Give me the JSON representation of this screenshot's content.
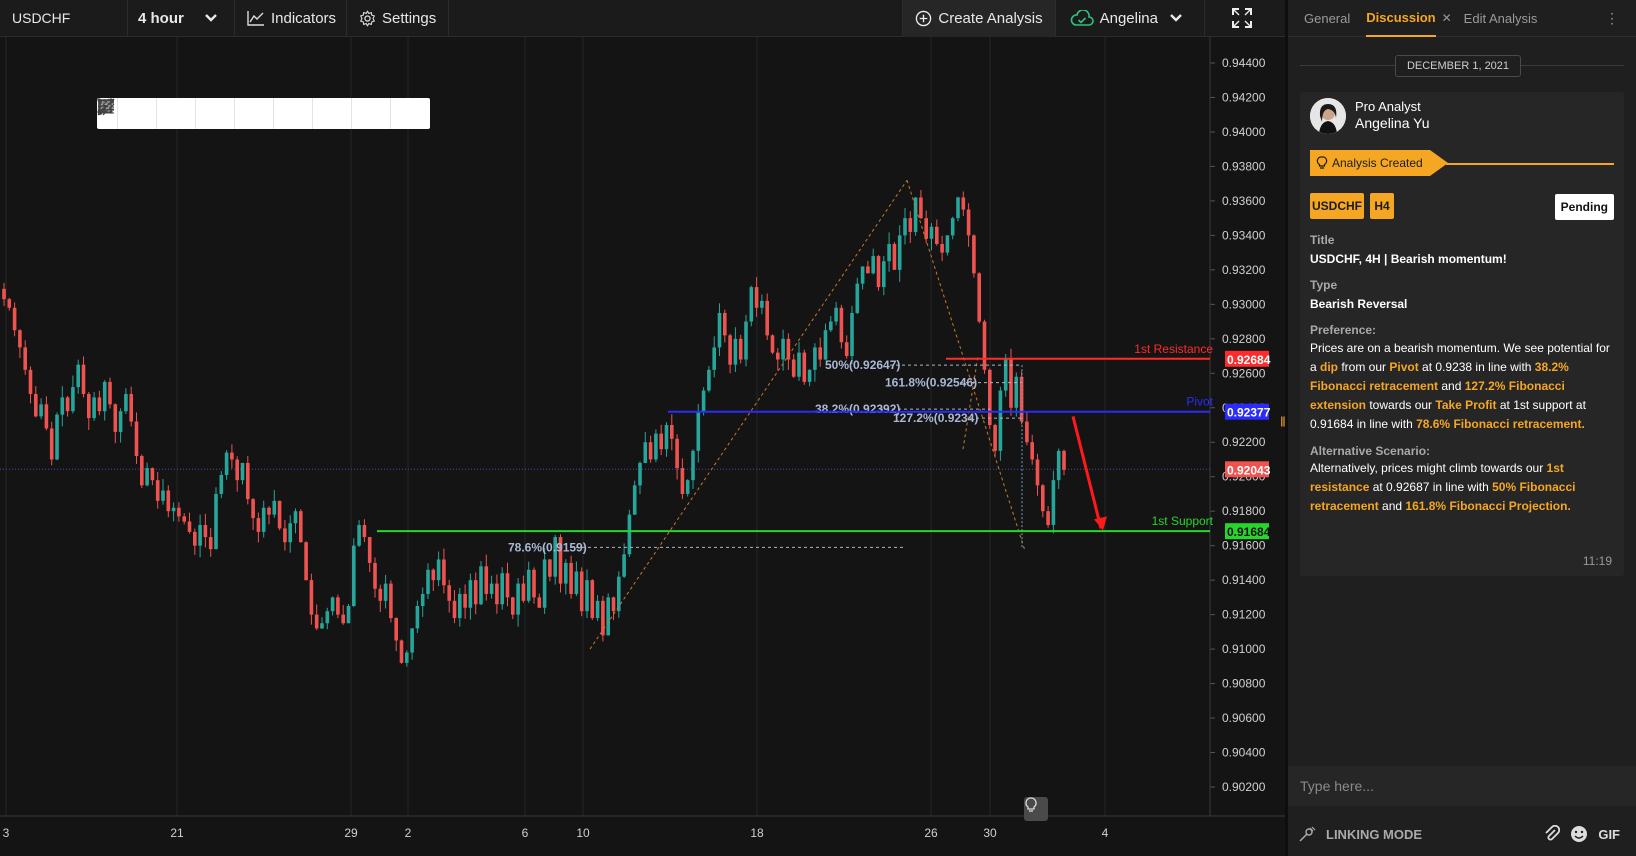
{
  "topbar": {
    "symbol": "USDCHF",
    "interval": "4 hour",
    "indicators": "Indicators",
    "settings": "Settings",
    "create_analysis": "Create Analysis",
    "user": "Angelina"
  },
  "chart_data": {
    "type": "candlestick",
    "symbol": "USDCHF",
    "timeframe": "4 hour",
    "ylim": [
      0.902,
      0.945
    ],
    "y_ticks": [
      "0.94400",
      "0.94200",
      "0.94000",
      "0.93800",
      "0.93600",
      "0.93400",
      "0.93200",
      "0.93000",
      "0.92800",
      "0.92600",
      "0.92400",
      "0.92200",
      "0.92000",
      "0.91800",
      "0.91600",
      "0.91400",
      "0.91200",
      "0.91000",
      "0.90800",
      "0.90600",
      "0.90400",
      "0.90200"
    ],
    "x_ticks": [
      "3",
      "21",
      "29",
      "2",
      "6",
      "10",
      "18",
      "26",
      "30",
      "4"
    ],
    "price_lines": [
      {
        "name": "1st Resistance",
        "value": "0.92684",
        "color": "#ff2b2b"
      },
      {
        "name": "Pivot",
        "value": "0.92377",
        "color": "#2b2bff"
      },
      {
        "name": "1st Support",
        "value": "0.91684",
        "color": "#27d62b"
      }
    ],
    "current_price": "0.92043",
    "fibonacci_labels": [
      {
        "text": "50%(0.92647)",
        "value": 0.92647
      },
      {
        "text": "161.8%(0.92546)",
        "value": 0.92546
      },
      {
        "text": "38.2%(0.92392)",
        "value": 0.92392
      },
      {
        "text": "127.2%(0.9234)",
        "value": 0.9234
      },
      {
        "text": "78.6%(0.9159)",
        "value": 0.9159
      }
    ],
    "path_close": [
      0.9303,
      0.9298,
      0.9285,
      0.9275,
      0.9262,
      0.9248,
      0.9235,
      0.9242,
      0.9228,
      0.921,
      0.9236,
      0.9246,
      0.9238,
      0.9252,
      0.9265,
      0.9248,
      0.9234,
      0.9246,
      0.9238,
      0.9255,
      0.9242,
      0.9226,
      0.9238,
      0.9248,
      0.9232,
      0.9212,
      0.9195,
      0.9205,
      0.9198,
      0.9186,
      0.9192,
      0.918,
      0.9182,
      0.9177,
      0.9174,
      0.9168,
      0.916,
      0.9172,
      0.9165,
      0.9158,
      0.919,
      0.9201,
      0.9214,
      0.921,
      0.9198,
      0.9208,
      0.9187,
      0.9176,
      0.9168,
      0.9182,
      0.9178,
      0.9186,
      0.917,
      0.9162,
      0.9173,
      0.918,
      0.9162,
      0.914,
      0.912,
      0.9112,
      0.9115,
      0.9122,
      0.913,
      0.912,
      0.9115,
      0.9125,
      0.916,
      0.9172,
      0.9165,
      0.915,
      0.9135,
      0.9128,
      0.9138,
      0.9118,
      0.9105,
      0.9092,
      0.9098,
      0.9112,
      0.9125,
      0.9132,
      0.9146,
      0.914,
      0.9152,
      0.9137,
      0.9128,
      0.9118,
      0.9132,
      0.9124,
      0.914,
      0.9126,
      0.9148,
      0.9132,
      0.9138,
      0.9126,
      0.9144,
      0.913,
      0.912,
      0.9138,
      0.9128,
      0.9146,
      0.913,
      0.9124,
      0.9152,
      0.9142,
      0.9165,
      0.9138,
      0.915,
      0.9132,
      0.9145,
      0.9122,
      0.914,
      0.9118,
      0.9128,
      0.9108,
      0.913,
      0.9122,
      0.9142,
      0.9155,
      0.9178,
      0.9195,
      0.9208,
      0.922,
      0.921,
      0.9225,
      0.9216,
      0.923,
      0.9222,
      0.9205,
      0.919,
      0.9198,
      0.9215,
      0.9238,
      0.925,
      0.9262,
      0.9275,
      0.9295,
      0.9282,
      0.9265,
      0.928,
      0.9268,
      0.929,
      0.931,
      0.9298,
      0.9302,
      0.9282,
      0.9272,
      0.9268,
      0.928,
      0.9268,
      0.9258,
      0.9272,
      0.9255,
      0.9262,
      0.9275,
      0.9268,
      0.9285,
      0.929,
      0.9298,
      0.9278,
      0.927,
      0.9295,
      0.9312,
      0.9322,
      0.9318,
      0.9328,
      0.931,
      0.9325,
      0.9335,
      0.932,
      0.934,
      0.935,
      0.9342,
      0.9362,
      0.935,
      0.9338,
      0.9345,
      0.9335,
      0.933,
      0.934,
      0.935,
      0.9362,
      0.9355,
      0.934,
      0.9318,
      0.929,
      0.9262,
      0.923,
      0.9215,
      0.925,
      0.9268,
      0.924,
      0.9258,
      0.9232,
      0.922,
      0.921,
      0.9195,
      0.918,
      0.9172,
      0.9198,
      0.9215,
      0.9204
    ],
    "annotations": [
      "bearish arrow toward 1st Support"
    ]
  },
  "panel": {
    "tabs": [
      "General",
      "Discussion",
      "Edit Analysis"
    ],
    "date": "DECEMBER 1, 2021",
    "role": "Pro Analyst",
    "author": "Angelina Yu",
    "status_tag": "Analysis Created",
    "symbol_badge": "USDCHF",
    "tf_badge": "H4",
    "pending": "Pending",
    "title_label": "Title",
    "title_value": "USDCHF, 4H | Bearish momentum!",
    "type_label": "Type",
    "type_value": "Bearish Reversal",
    "pref_label": "Preference:",
    "pref": {
      "t1": "Prices are on a bearish momentum. We see potential for a ",
      "h1": "dip",
      "t2": " from our ",
      "h2": "Pivot",
      "t3": " at 0.9238 in line with ",
      "h3": "38.2% Fibonacci retracement",
      "t4": " and ",
      "h4": "127.2% Fibonacci extension",
      "t5": " towards our ",
      "h5": "Take Profit",
      "t6": " at 1st support at 0.91684 in line with ",
      "h6": "78.6% Fibonacci retracement.",
      "t7": ""
    },
    "alt_label": "Alternative Scenario:",
    "alt": {
      "t1": "Alternatively, prices might climb towards our ",
      "h1": "1st resistance",
      "t2": " at 0.92687 in line with ",
      "h2": "50% Fibonacci retracement",
      "t3": " and ",
      "h3": "161.8% Fibonacci Projection.",
      "t4": ""
    },
    "time": "11:19",
    "message_placeholder": "Type here...",
    "linking_mode": "LINKING MODE",
    "gif": "GIF"
  }
}
